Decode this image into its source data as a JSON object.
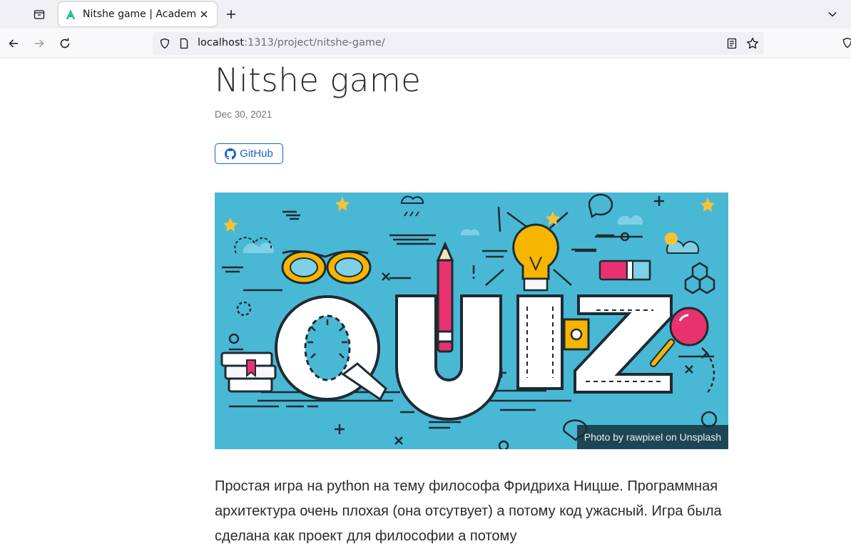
{
  "browser": {
    "tab": {
      "title": "Nitshe game | Academic"
    },
    "urlbar": {
      "host": "localhost",
      "path": ":1313/project/nitshe-game/"
    },
    "icons": {
      "tab_list": "tab-list-icon",
      "favicon": "academic-logo-icon",
      "close_tab": "close-icon",
      "new_tab": "plus-icon",
      "list_all_tabs": "chevron-down-icon",
      "back": "arrow-left-icon",
      "forward": "arrow-right-icon",
      "reload": "reload-icon",
      "tracking_protection": "shield-icon",
      "page_info": "page-icon",
      "reader_view": "reader-view-icon",
      "bookmark": "star-icon"
    }
  },
  "page": {
    "title": "Nitshe game",
    "date": "Dec 30, 2021",
    "github_button": {
      "label": "GitHub",
      "icon": "github-icon"
    },
    "featured_image": {
      "letters": [
        "Q",
        "U",
        "I",
        "Z"
      ],
      "caption": "Photo by rawpixel on Unsplash",
      "colors": {
        "background": "#49b8d5",
        "accent_pink": "#e8326e",
        "accent_yellow": "#f7b500",
        "dark": "#2b2b2b"
      }
    },
    "body": "Простая игра на python на тему философа Фридриха Ницше. Программная архитектура очень плохая (она отсутвует) а потому код ужасный. Игра была сделана как проект для философии а потому"
  },
  "colors": {
    "link": "#1565c0",
    "muted_text": "#6c757d",
    "text": "#2b2b2b",
    "favicon": "#26c6a0"
  }
}
